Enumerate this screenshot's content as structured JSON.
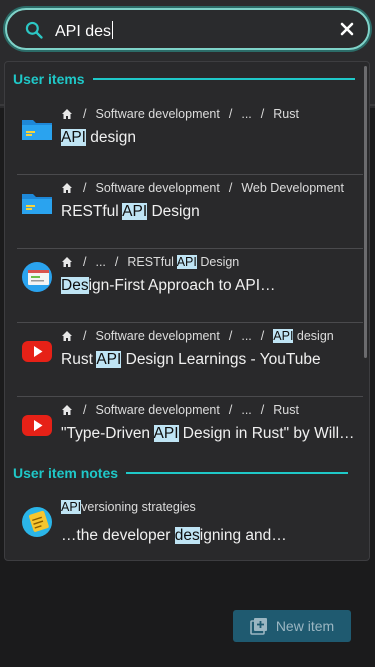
{
  "search": {
    "value": "API des"
  },
  "sections": {
    "user_items": "User items",
    "user_item_notes": "User item notes"
  },
  "breadcrumb_sep": "/",
  "items": [
    {
      "crumbs": [
        "Software development",
        "...",
        "Rust"
      ],
      "title": [
        [
          "API",
          true
        ],
        [
          " design",
          false
        ]
      ],
      "icon": "folder-icon"
    },
    {
      "crumbs": [
        "Software development",
        "Web Development"
      ],
      "title": [
        [
          "RESTful ",
          false
        ],
        [
          "API",
          true
        ],
        [
          " Design",
          false
        ]
      ],
      "icon": "folder-icon"
    },
    {
      "crumbs": [
        "...",
        "RESTful API Design"
      ],
      "title": [
        [
          "Des",
          true
        ],
        [
          "ign-First Approach to API…",
          false
        ]
      ],
      "icon": "web-page-icon"
    },
    {
      "crumbs": [
        "Software development",
        "...",
        "API design"
      ],
      "title": [
        [
          "Rust ",
          false
        ],
        [
          "API",
          true
        ],
        [
          " Design Learnings - YouTube",
          false
        ]
      ],
      "icon": "youtube-icon"
    },
    {
      "crumbs": [
        "Software development",
        "...",
        "Rust"
      ],
      "title": [
        [
          "\"Type-Driven ",
          false
        ],
        [
          "API",
          true
        ],
        [
          " Design in Rust\" by Will…",
          false
        ]
      ],
      "icon": "youtube-icon"
    }
  ],
  "note": {
    "heading_hl": "API",
    "heading_rest": " versioning strategies",
    "pre": "…the developer ",
    "hl": "des",
    "post": "igning and…",
    "icon": "sticky-note-icon"
  },
  "new_item_button": "New item",
  "colors": {
    "accent": "#1fc8c8",
    "highlight": "#bfe4f4",
    "button": "#1f5a70"
  }
}
